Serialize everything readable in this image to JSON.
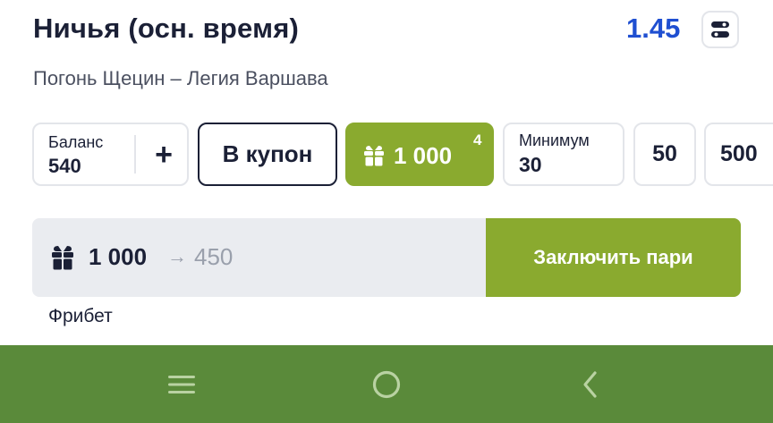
{
  "bet": {
    "title": "Ничья (осн. время)",
    "odds": "1.45",
    "match": "Погонь Щецин – Легия Варшава"
  },
  "balance": {
    "label": "Баланс",
    "value": "540",
    "add_label": "+"
  },
  "coupon_label": "В купон",
  "freebet_chip": {
    "amount": "1 000",
    "count": "4"
  },
  "minimum": {
    "label": "Минимум",
    "value": "30"
  },
  "quick_stakes": [
    "50",
    "500"
  ],
  "bet_bar": {
    "stake": "1 000",
    "arrow": "→",
    "potential_win": "450",
    "place_label": "Заключить пари"
  },
  "freebet_note": "Фрибет",
  "colors": {
    "accent": "#8aaa2f",
    "odds": "#1f4fd1",
    "navbar": "#5a8a3a",
    "text": "#1b2036"
  },
  "icons": [
    "toggle-icon",
    "gift-icon",
    "menu-icon",
    "home-icon",
    "back-icon"
  ]
}
